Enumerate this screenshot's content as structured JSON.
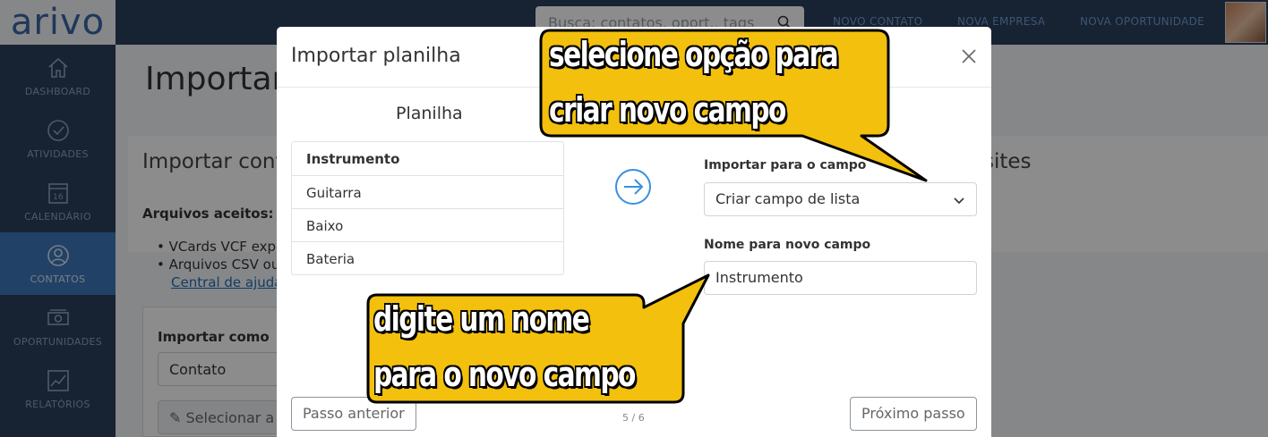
{
  "app": {
    "logo": "arivo"
  },
  "topbar": {
    "search_placeholder": "Busca: contatos, oport., tags",
    "nav": [
      "NOVO CONTATO",
      "NOVA EMPRESA",
      "NOVA OPORTUNIDADE"
    ]
  },
  "sidebar": {
    "items": [
      {
        "label": "DASHBOARD",
        "icon": "home-icon"
      },
      {
        "label": "ATIVIDADES",
        "icon": "check-circle-icon"
      },
      {
        "label": "CALENDÁRIO",
        "icon": "calendar-icon",
        "day": "16"
      },
      {
        "label": "CONTATOS",
        "icon": "user-icon",
        "active": true
      },
      {
        "label": "OPORTUNIDADES",
        "icon": "money-icon"
      },
      {
        "label": "RELATÓRIOS",
        "icon": "chart-icon"
      }
    ]
  },
  "background": {
    "page_title": "Importar",
    "panel_title": "Importar conta",
    "panel_title_right": "sites",
    "accepted_label": "Arquivos aceitos:",
    "bullets": [
      "VCards VCF expo",
      "Arquivos CSV ou"
    ],
    "help_link": "Central de ajuda",
    "import_as_label": "Importar como",
    "import_as_value": "Contato",
    "select_file": "Selecionar a"
  },
  "modal": {
    "title": "Importar planilha",
    "sheet_title": "Planilha",
    "sheet_rows": [
      "Instrumento",
      "Guitarra",
      "Baixo",
      "Bateria"
    ],
    "import_to_label": "Importar para o campo",
    "import_to_value": "Criar campo de lista",
    "new_field_label": "Nome para novo campo",
    "new_field_value": "Instrumento",
    "prev_button": "Passo anterior",
    "next_button": "Próximo passo",
    "step": "5 / 6"
  },
  "callouts": {
    "top": [
      "selecione opção para",
      "criar novo campo"
    ],
    "bottom": [
      "digite um nome",
      "para o novo campo"
    ],
    "fill_color": "#f2c00d"
  }
}
